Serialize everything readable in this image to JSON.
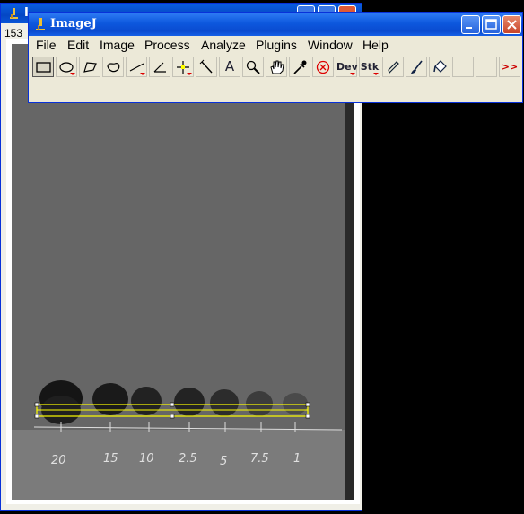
{
  "image_window": {
    "title": "I",
    "info": "153",
    "selection_color": "#ffff00",
    "plate_labels": [
      "20",
      "15",
      "10",
      "2.5",
      "5",
      "7.5",
      "1"
    ]
  },
  "imagej": {
    "title": "ImageJ",
    "menu": [
      "File",
      "Edit",
      "Image",
      "Process",
      "Analyze",
      "Plugins",
      "Window",
      "Help"
    ],
    "tools": [
      {
        "name": "rectangle-tool-icon",
        "label": ""
      },
      {
        "name": "oval-tool-icon",
        "label": ""
      },
      {
        "name": "polygon-tool-icon",
        "label": ""
      },
      {
        "name": "freehand-tool-icon",
        "label": ""
      },
      {
        "name": "line-tool-icon",
        "label": ""
      },
      {
        "name": "angle-tool-icon",
        "label": ""
      },
      {
        "name": "point-tool-icon",
        "label": ""
      },
      {
        "name": "wand-tool-icon",
        "label": ""
      },
      {
        "name": "text-tool-icon",
        "label": "A"
      },
      {
        "name": "magnifier-tool-icon",
        "label": ""
      },
      {
        "name": "hand-tool-icon",
        "label": ""
      },
      {
        "name": "color-picker-icon",
        "label": ""
      },
      {
        "name": "close-roi-icon",
        "label": ""
      },
      {
        "name": "dev-tool",
        "label": "Dev"
      },
      {
        "name": "stk-tool",
        "label": "Stk"
      },
      {
        "name": "pencil-tool-icon",
        "label": ""
      },
      {
        "name": "brush-tool-icon",
        "label": ""
      },
      {
        "name": "flood-fill-tool-icon",
        "label": ""
      },
      {
        "name": "more-tools-icon",
        "label": ">>"
      }
    ]
  }
}
